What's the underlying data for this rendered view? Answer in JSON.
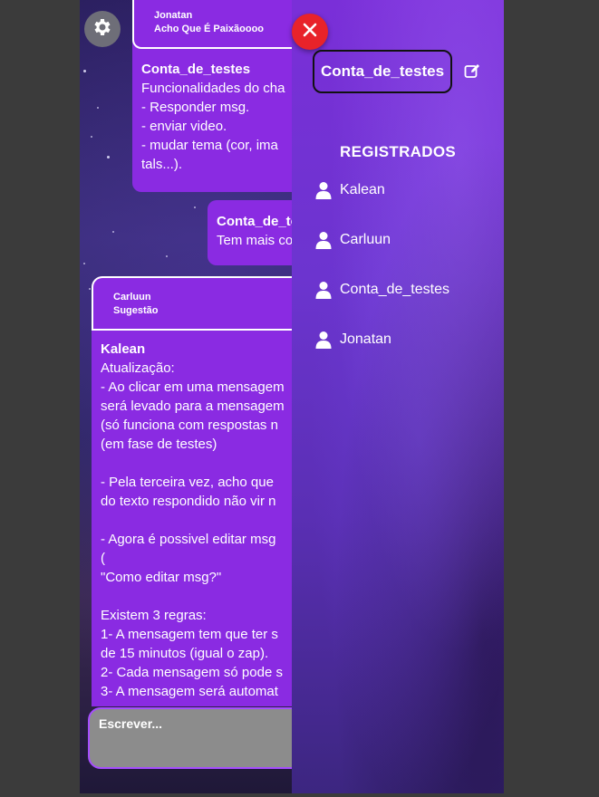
{
  "settings": {
    "icon": "gear-icon"
  },
  "messages": [
    {
      "reply": {
        "author": "Jonatan",
        "text": "Acho Que É Paixãoooo"
      },
      "author": "Conta_de_testes",
      "body": "Funcionalidades do cha\n- Responder msg.\n- enviar video.\n- mudar tema (cor, ima\ntals...)."
    },
    {
      "author": "Conta_de_te",
      "body": "Tem mais co"
    },
    {
      "reply": {
        "author": "Carluun",
        "text": "Sugestão"
      },
      "author": "Kalean",
      "body": "Atualização:\n- Ao clicar em uma mensagem\nserá levado para a mensagem\n(só funciona com respostas n\n(em fase de testes)\n\n- Pela terceira vez, acho que\ndo texto respondido não vir n\n\n- Agora é possivel editar msg\n(\n\"Como editar msg?\"\n\nExistem 3 regras:\n1- A mensagem tem que ter s\nde 15 minutos (igual o zap).\n2- Cada mensagem só pode s\n3- A mensagem será automat"
    }
  ],
  "composer": {
    "placeholder": "Escrever..."
  },
  "panel": {
    "close_icon": "close-icon",
    "account_name": "Conta_de_testes",
    "edit_icon": "edit-icon",
    "registered_title": "REGISTRADOS",
    "users": [
      "Kalean",
      "Carluun",
      "Conta_de_testes",
      "Jonatan"
    ]
  },
  "colors": {
    "message_bg": "#8a2be2",
    "close_button": "#e8232a",
    "composer_border": "#a64dff"
  }
}
